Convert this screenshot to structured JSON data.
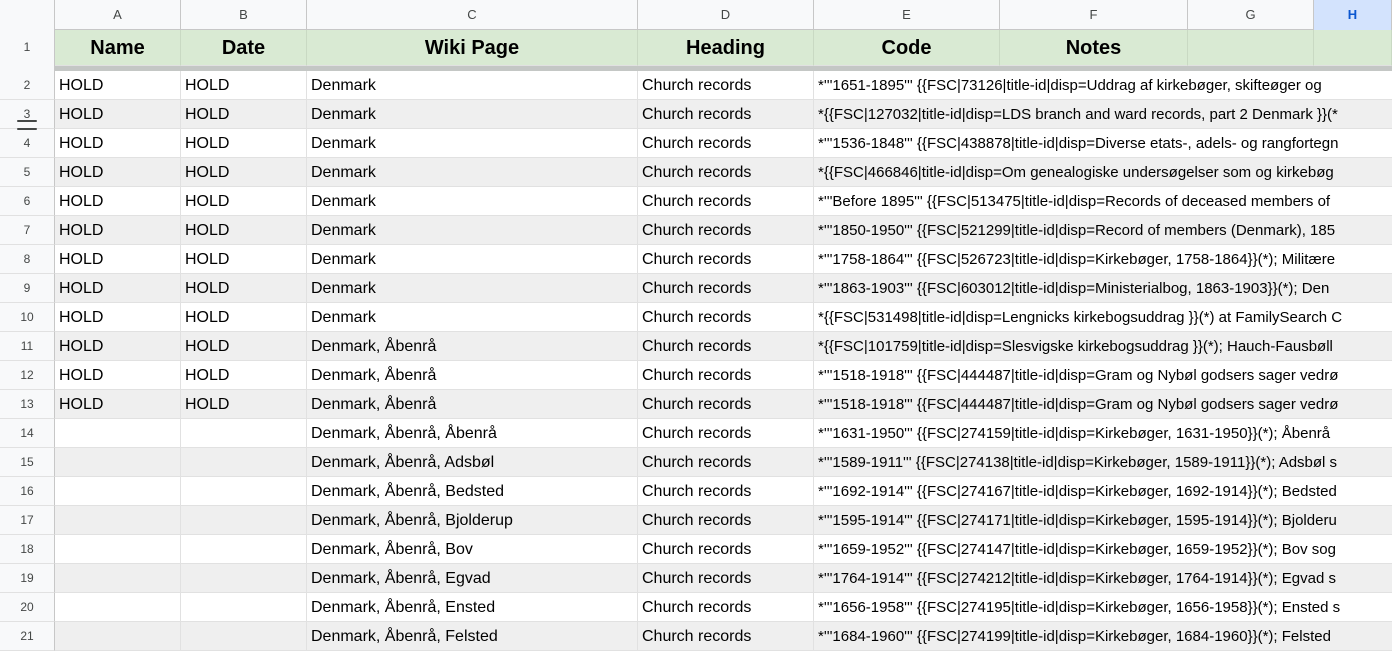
{
  "columns": [
    "A",
    "B",
    "C",
    "D",
    "E",
    "F",
    "G",
    "H"
  ],
  "selected_column": "H",
  "header": {
    "row_number": "1",
    "cells": [
      "Name",
      "Date",
      "Wiki Page",
      "Heading",
      "Code",
      "Notes",
      "",
      ""
    ]
  },
  "rows": [
    {
      "num": "2",
      "name": "HOLD",
      "date": "HOLD",
      "wiki": "Denmark",
      "heading": "Church records",
      "code": "*'''1651-1895''' {{FSC|73126|title-id|disp=Uddrag af kirkebøger, skifteøger og"
    },
    {
      "num": "3",
      "name": "HOLD",
      "date": "HOLD",
      "wiki": "Denmark",
      "heading": "Church records",
      "code": "*{{FSC|127032|title-id|disp=LDS branch and ward records, part 2 Denmark }}(*"
    },
    {
      "num": "4",
      "name": "HOLD",
      "date": "HOLD",
      "wiki": "Denmark",
      "heading": "Church records",
      "code": "*'''1536-1848''' {{FSC|438878|title-id|disp=Diverse etats-, adels- og rangfortegn"
    },
    {
      "num": "5",
      "name": "HOLD",
      "date": "HOLD",
      "wiki": "Denmark",
      "heading": "Church records",
      "code": "*{{FSC|466846|title-id|disp=Om genealogiske undersøgelser som og kirkebøg"
    },
    {
      "num": "6",
      "name": "HOLD",
      "date": "HOLD",
      "wiki": "Denmark",
      "heading": "Church records",
      "code": "*'''Before 1895''' {{FSC|513475|title-id|disp=Records of deceased members of"
    },
    {
      "num": "7",
      "name": "HOLD",
      "date": "HOLD",
      "wiki": "Denmark",
      "heading": "Church records",
      "code": "*'''1850-1950''' {{FSC|521299|title-id|disp=Record of members (Denmark), 185"
    },
    {
      "num": "8",
      "name": "HOLD",
      "date": "HOLD",
      "wiki": "Denmark",
      "heading": "Church records",
      "code": "*'''1758-1864''' {{FSC|526723|title-id|disp=Kirkebøger, 1758-1864}}(*); Militære"
    },
    {
      "num": "9",
      "name": "HOLD",
      "date": "HOLD",
      "wiki": "Denmark",
      "heading": "Church records",
      "code": "*'''1863-1903''' {{FSC|603012|title-id|disp=Ministerialbog, 1863-1903}}(*); Den"
    },
    {
      "num": "10",
      "name": "HOLD",
      "date": "HOLD",
      "wiki": "Denmark",
      "heading": "Church records",
      "code": "*{{FSC|531498|title-id|disp=Lengnicks kirkebogsuddrag }}(*) at FamilySearch C"
    },
    {
      "num": "11",
      "name": "HOLD",
      "date": "HOLD",
      "wiki": "Denmark, Åbenrå",
      "heading": "Church records",
      "code": "*{{FSC|101759|title-id|disp=Slesvigske kirkebogsuddrag }}(*); Hauch-Fausbøll"
    },
    {
      "num": "12",
      "name": "HOLD",
      "date": "HOLD",
      "wiki": "Denmark, Åbenrå",
      "heading": "Church records",
      "code": "*'''1518-1918''' {{FSC|444487|title-id|disp=Gram og Nybøl godsers sager vedrø"
    },
    {
      "num": "13",
      "name": "HOLD",
      "date": "HOLD",
      "wiki": "Denmark, Åbenrå",
      "heading": "Church records",
      "code": "*'''1518-1918''' {{FSC|444487|title-id|disp=Gram og Nybøl godsers sager vedrø"
    },
    {
      "num": "14",
      "name": "",
      "date": "",
      "wiki": "Denmark, Åbenrå, Åbenrå",
      "heading": "Church records",
      "code": "*'''1631-1950''' {{FSC|274159|title-id|disp=Kirkebøger, 1631-1950}}(*); Åbenrå"
    },
    {
      "num": "15",
      "name": "",
      "date": "",
      "wiki": "Denmark, Åbenrå, Adsbøl",
      "heading": "Church records",
      "code": "*'''1589-1911''' {{FSC|274138|title-id|disp=Kirkebøger, 1589-1911}}(*); Adsbøl s"
    },
    {
      "num": "16",
      "name": "",
      "date": "",
      "wiki": "Denmark, Åbenrå, Bedsted",
      "heading": "Church records",
      "code": "*'''1692-1914''' {{FSC|274167|title-id|disp=Kirkebøger, 1692-1914}}(*); Bedsted"
    },
    {
      "num": "17",
      "name": "",
      "date": "",
      "wiki": "Denmark, Åbenrå, Bjolderup",
      "heading": "Church records",
      "code": "*'''1595-1914''' {{FSC|274171|title-id|disp=Kirkebøger, 1595-1914}}(*); Bjolderu"
    },
    {
      "num": "18",
      "name": "",
      "date": "",
      "wiki": "Denmark, Åbenrå, Bov",
      "heading": "Church records",
      "code": "*'''1659-1952''' {{FSC|274147|title-id|disp=Kirkebøger, 1659-1952}}(*); Bov sog"
    },
    {
      "num": "19",
      "name": "",
      "date": "",
      "wiki": "Denmark, Åbenrå, Egvad",
      "heading": "Church records",
      "code": "*'''1764-1914''' {{FSC|274212|title-id|disp=Kirkebøger, 1764-1914}}(*); Egvad s"
    },
    {
      "num": "20",
      "name": "",
      "date": "",
      "wiki": "Denmark, Åbenrå, Ensted",
      "heading": "Church records",
      "code": "*'''1656-1958''' {{FSC|274195|title-id|disp=Kirkebøger, 1656-1958}}(*); Ensted s"
    },
    {
      "num": "21",
      "name": "",
      "date": "",
      "wiki": "Denmark, Åbenrå, Felsted",
      "heading": "Church records",
      "code": "*'''1684-1960''' {{FSC|274199|title-id|disp=Kirkebøger, 1684-1960}}(*); Felsted"
    }
  ]
}
